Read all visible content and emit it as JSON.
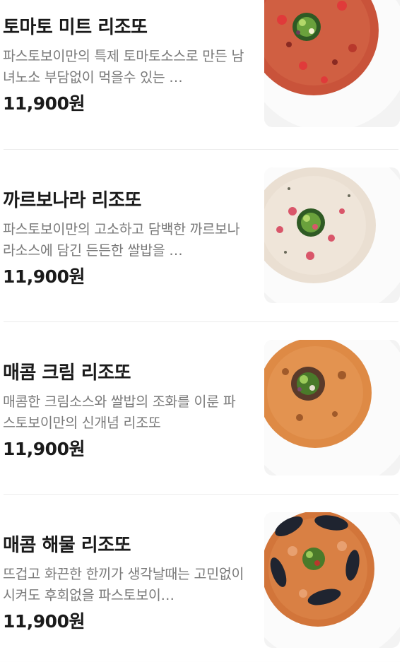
{
  "menu": {
    "items": [
      {
        "name": "토마토 미트 리조또",
        "description": "파스토보이만의 특제 토마토소스로 만든 남녀노소 부담없이 먹을수 있는 …",
        "price": "11,900원",
        "image": "tomato-meat-risotto-photo",
        "colors": {
          "risotto": "#c9533a",
          "accent": "#e03a3a",
          "plate": "#f3f3f3"
        }
      },
      {
        "name": "까르보나라 리조또",
        "description": "파스토보이만의 고소하고 담백한 까르보나라소스에 담긴 든든한 쌀밥을 …",
        "price": "11,900원",
        "image": "carbonara-risotto-photo",
        "colors": {
          "risotto": "#eadfd2",
          "accent": "#d9566a",
          "plate": "#f3f3f3"
        }
      },
      {
        "name": "매콤 크림 리조또",
        "description": "매콤한 크림소스와 쌀밥의 조화를 이룬 파스토보이만의 신개념 리조또",
        "price": "11,900원",
        "image": "spicy-cream-risotto-photo",
        "colors": {
          "risotto": "#de8a45",
          "accent": "#7a4a2a",
          "plate": "#f3f3f3"
        }
      },
      {
        "name": "매콤 해물 리조또",
        "description": "뜨겁고 화끈한 한끼가 생각날때는 고민없이 시켜도 후회없을 파스토보이…",
        "price": "11,900원",
        "image": "spicy-seafood-risotto-photo",
        "colors": {
          "risotto": "#d2753a",
          "accent": "#1f2430",
          "plate": "#f3f3f3"
        }
      }
    ]
  }
}
